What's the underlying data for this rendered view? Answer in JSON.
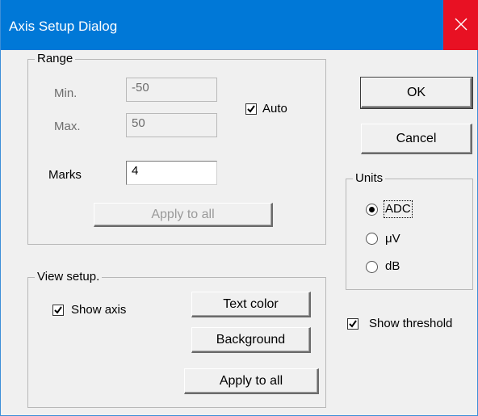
{
  "window": {
    "title": "Axis Setup Dialog"
  },
  "range": {
    "group_label": "Range",
    "min_label": "Min.",
    "min_value": "-50",
    "max_label": "Max.",
    "max_value": "50",
    "marks_label": "Marks",
    "marks_value": "4",
    "auto_label": "Auto",
    "auto_checked": true,
    "apply_label": "Apply to all"
  },
  "view": {
    "group_label": "View setup.",
    "show_axis_label": "Show axis",
    "show_axis_checked": true,
    "text_color_label": "Text color",
    "background_label": "Background",
    "apply_label": "Apply to all"
  },
  "buttons": {
    "ok": "OK",
    "cancel": "Cancel"
  },
  "units": {
    "group_label": "Units",
    "options": [
      "ADC",
      "μV",
      "dB"
    ],
    "selected": "ADC"
  },
  "threshold": {
    "label": "Show threshold",
    "checked": true
  },
  "colors": {
    "titlebar": "#0078d7",
    "close": "#e81123",
    "face": "#f0f0f0"
  }
}
